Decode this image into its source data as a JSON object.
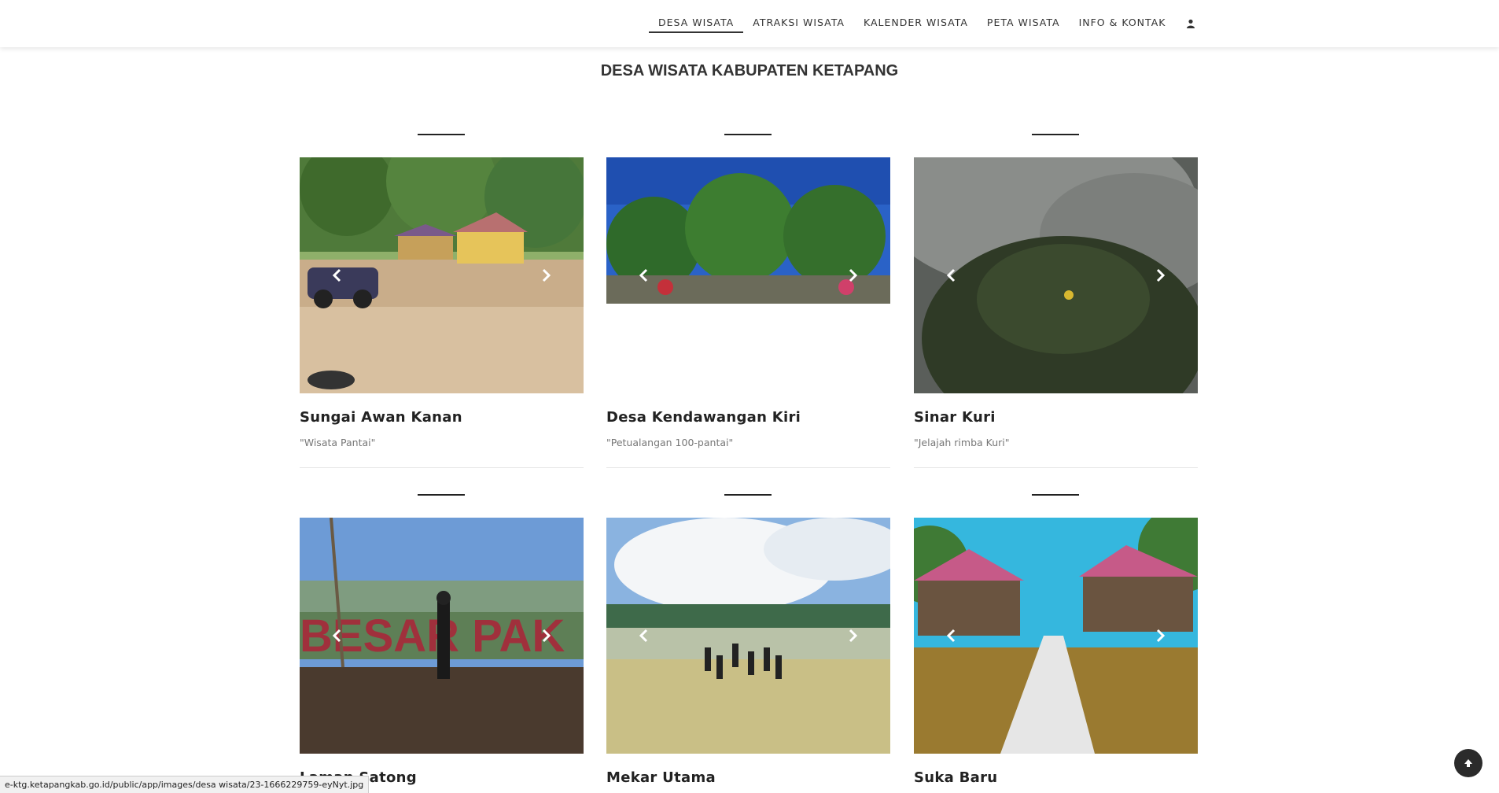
{
  "nav": {
    "items": [
      {
        "label": "DESA WISATA",
        "active": true
      },
      {
        "label": "ATRAKSI WISATA"
      },
      {
        "label": "KALENDER WISATA"
      },
      {
        "label": "PETA WISATA"
      },
      {
        "label": "INFO & KONTAK"
      }
    ],
    "user_icon": "user-icon"
  },
  "page": {
    "title": "DESA WISATA KABUPATEN KETAPANG"
  },
  "cards": [
    {
      "title": "Sungai Awan Kanan",
      "subtitle": "\"Wisata Pantai\""
    },
    {
      "title": "Desa Kendawangan Kiri",
      "subtitle": "\"Petualangan 100-pantai\""
    },
    {
      "title": "Sinar Kuri",
      "subtitle": "\"Jelajah rimba Kuri\""
    },
    {
      "title": "Laman Satong",
      "subtitle": ""
    },
    {
      "title": "Mekar Utama",
      "subtitle": ""
    },
    {
      "title": "Suka Baru",
      "subtitle": ""
    }
  ],
  "status_url": "e-ktg.ketapangkab.go.id/public/app/images/desa wisata/23-1666229759-eyNyt.jpg",
  "icons": {
    "prev": "chevron-left-icon",
    "next": "chevron-right-icon",
    "top": "arrow-up-icon"
  }
}
